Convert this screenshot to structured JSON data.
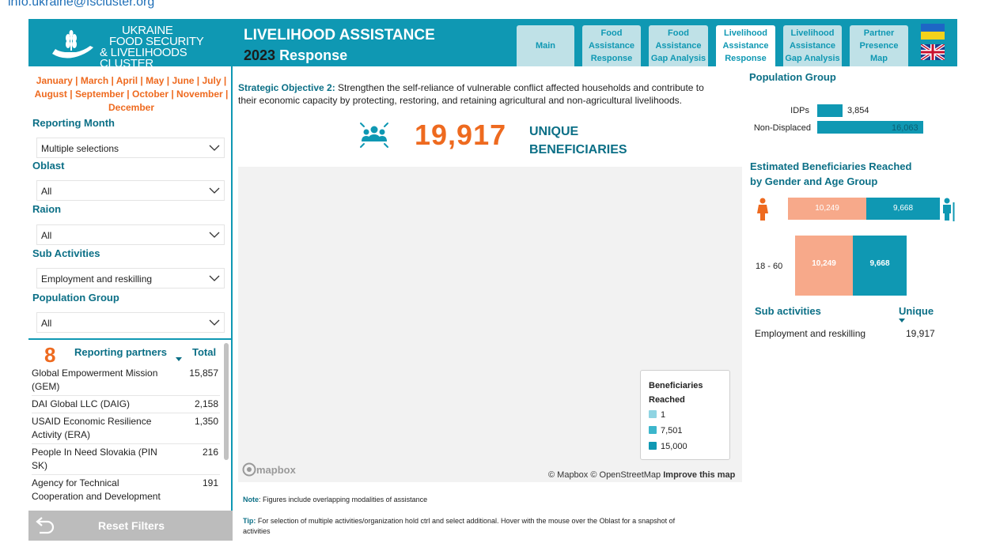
{
  "header": {
    "email_fragment": "info.ukraine@fscluster.org",
    "logo_lines": [
      "UKRAINE",
      "FOOD SECURITY",
      "& LIVELIHOODS CLUSTER"
    ],
    "title": "LIVELIHOOD ASSISTANCE",
    "year": "2023",
    "subtitle": "Response",
    "tabs": [
      {
        "label": "Main",
        "active": false
      },
      {
        "label": "Food Assistance Response",
        "active": false
      },
      {
        "label": "Food Assistance Gap Analysis",
        "active": false
      },
      {
        "label": "Livelihood Assistance Response",
        "active": true
      },
      {
        "label": "Livelihood Assistance Gap Analysis",
        "active": false
      },
      {
        "label": "Partner Presence Map",
        "active": false
      }
    ],
    "accent_color": "#0f98b3"
  },
  "filters": {
    "months_text": "January | March | April | May | June | July | August | September | October | November | December",
    "reporting_month": {
      "label": "Reporting Month",
      "value": "Multiple selections"
    },
    "oblast": {
      "label": "Oblast",
      "value": "All"
    },
    "raion": {
      "label": "Raion",
      "value": "All"
    },
    "sub_activities": {
      "label": "Sub Activities",
      "value": "Employment and reskilling"
    },
    "population_group": {
      "label": "Population Group",
      "value": "All"
    }
  },
  "partners": {
    "count": "8",
    "label": "Reporting partners",
    "total_label": "Total",
    "rows": [
      {
        "name": "Global Empowerment Mission (GEM)",
        "total": "15,857"
      },
      {
        "name": "DAI Global LLC (DAIG)",
        "total": "2,158"
      },
      {
        "name": "USAID Economic Resilience Activity (ERA)",
        "total": "1,350"
      },
      {
        "name": "People In Need Slovakia (PIN SK)",
        "total": "216"
      },
      {
        "name": "Agency for Technical Cooperation and Development (ACTED)",
        "total": "191"
      }
    ]
  },
  "reset_label": "Reset Filters",
  "objective": {
    "prefix": "Strategic Objective 2:",
    "text": " Strengthen the self-reliance of vulnerable conflict affected households and contribute to their economic capacity by protecting, restoring, and retaining agricultural and non-agricultural livelihoods."
  },
  "kpi": {
    "value": "19,917",
    "label_line1": "UNIQUE",
    "label_line2": "BENEFICIARIES"
  },
  "map": {
    "legend_title": "Beneficiaries Reached",
    "legend_items": [
      {
        "label": "1",
        "color": "#8fd4e2"
      },
      {
        "label": "7,501",
        "color": "#3cb6cc"
      },
      {
        "label": "15,000",
        "color": "#0f98b3"
      }
    ],
    "logo": "mapbox",
    "attribution": "© Mapbox © OpenStreetMap",
    "improve": "Improve this map"
  },
  "note": {
    "prefix": "Note",
    "text": ": Figures include overlapping modalities of assistance"
  },
  "tip": {
    "prefix": "Tip:",
    "text": " For selection of multiple activities/organization hold ctrl and select additional. Hover with the mouse over the Oblast for a snapshot of activities"
  },
  "population_group": {
    "title": "Population Group",
    "rows": [
      {
        "label": "IDPs",
        "value": 3854,
        "value_text": "3,854"
      },
      {
        "label": "Non-Displaced",
        "value": 16063,
        "value_text": "16,063"
      }
    ]
  },
  "gender_age": {
    "title_line1": "Estimated Beneficiaries Reached",
    "title_line2": "by Gender and Age Group",
    "female": 10249,
    "female_text": "10,249",
    "male": 9668,
    "male_text": "9,668",
    "age_group": "18 - 60",
    "female_color": "#f7a98a",
    "male_color": "#0f98b3"
  },
  "sub_activities": {
    "label": "Sub activities",
    "unique_label": "Unique",
    "rows": [
      {
        "name": "Employment and reskilling",
        "value": "19,917"
      }
    ]
  }
}
